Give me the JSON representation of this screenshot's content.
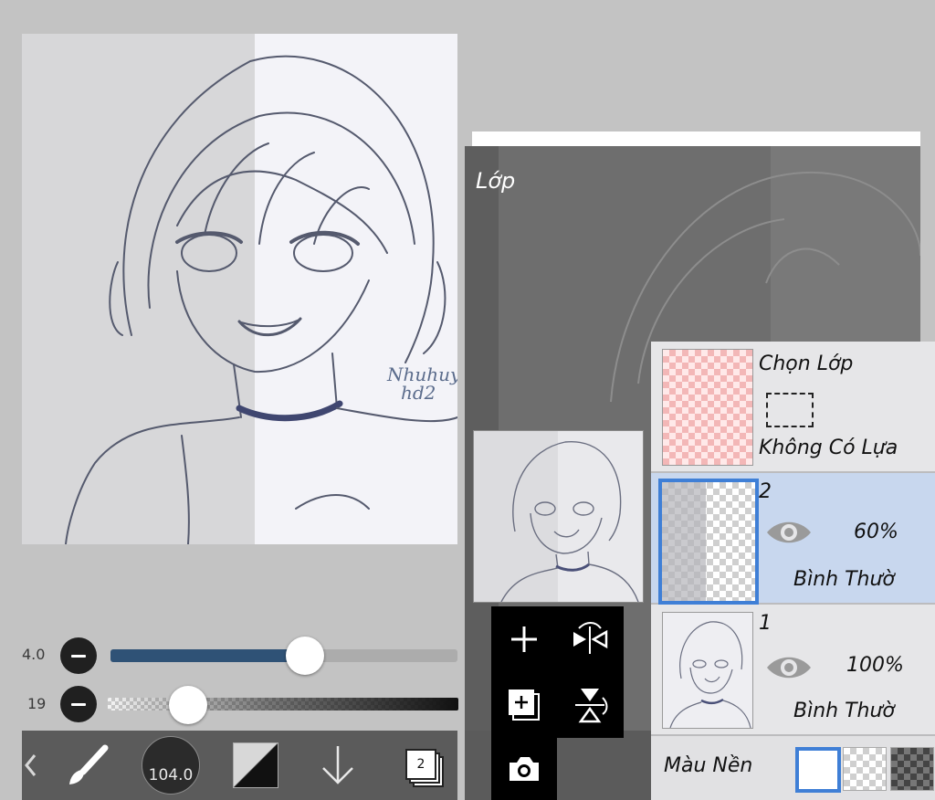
{
  "canvas": {
    "signature_line1": "Nhuhuy",
    "signature_line2": "hd2"
  },
  "sliders": {
    "brush_size_value": "4.0",
    "brush_size_level": 0.56,
    "opacity_value": "19",
    "opacity_level": 0.23
  },
  "toolbar": {
    "brush_size_label": "104.0",
    "layer_count": "2"
  },
  "layer_panel": {
    "title": "Lớp",
    "selection_layer": {
      "name": "Chọn Lớp",
      "status": "Không Có Lựa"
    },
    "layers": [
      {
        "number": "2",
        "opacity": "60%",
        "blend_mode": "Bình Thườ"
      },
      {
        "number": "1",
        "opacity": "100%",
        "blend_mode": "Bình Thườ"
      }
    ],
    "background_label": "Màu Nền"
  },
  "colors": {
    "accent": "#2f5276",
    "selected_layer_bg": "#c8d7ee",
    "selected_border": "#3f7fd6",
    "toolbar_bg": "#5b5b5b"
  }
}
